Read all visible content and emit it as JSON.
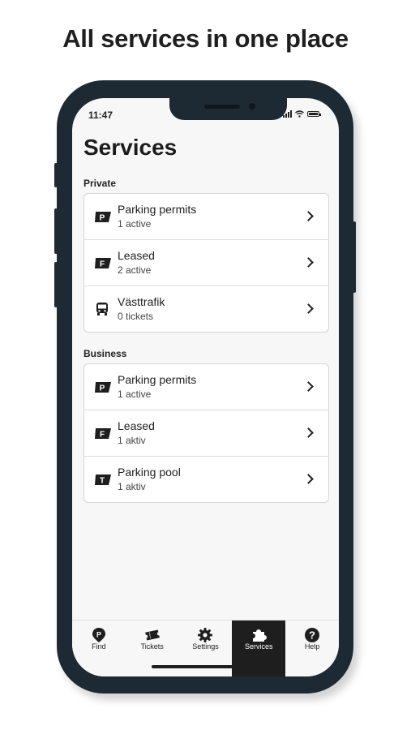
{
  "headline": "All services in one place",
  "status_bar": {
    "time": "11:47"
  },
  "page": {
    "title": "Services"
  },
  "sections": [
    {
      "label": "Private",
      "items": [
        {
          "icon": "parking-permit-icon",
          "badge": "P",
          "title": "Parking permits",
          "subtitle": "1 active"
        },
        {
          "icon": "leased-icon",
          "badge": "F",
          "title": "Leased",
          "subtitle": "2 active"
        },
        {
          "icon": "bus-icon",
          "title": "Västtrafik",
          "subtitle": "0 tickets"
        }
      ]
    },
    {
      "label": "Business",
      "items": [
        {
          "icon": "parking-permit-icon",
          "badge": "P",
          "title": "Parking permits",
          "subtitle": "1 active"
        },
        {
          "icon": "leased-icon",
          "badge": "F",
          "title": "Leased",
          "subtitle": "1 aktiv"
        },
        {
          "icon": "parking-pool-icon",
          "badge": "T",
          "title": "Parking pool",
          "subtitle": "1 aktiv"
        }
      ]
    }
  ],
  "tabbar": {
    "tabs": [
      {
        "label": "Find",
        "icon": "find-parking-icon"
      },
      {
        "label": "Tickets",
        "icon": "tickets-icon"
      },
      {
        "label": "Settings",
        "icon": "gear-icon"
      },
      {
        "label": "Services",
        "icon": "puzzle-icon",
        "active": true
      },
      {
        "label": "Help",
        "icon": "help-icon"
      }
    ]
  },
  "colors": {
    "phone_frame": "#1e2a33",
    "screen_bg": "#f7f7f7",
    "active_tab": "#1e1e1e"
  }
}
